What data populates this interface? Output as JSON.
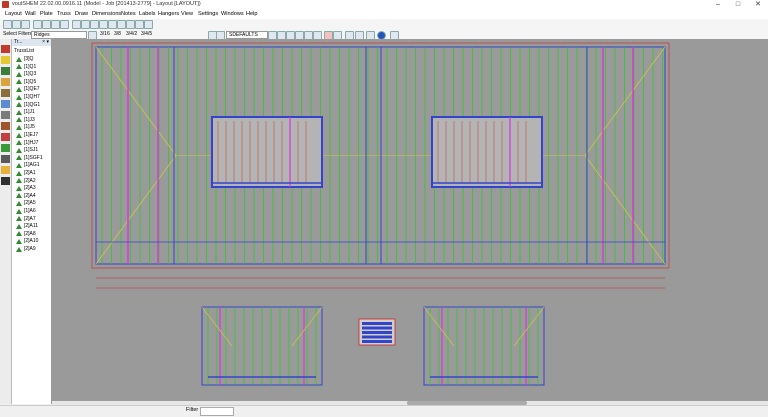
{
  "window": {
    "title": "voutSHEM 22.02.00.0916.11 (Model - Job [201413-2779] - Layout [LAYOUT])",
    "minimize": "–",
    "maximize": "□",
    "close": "✕"
  },
  "menu": [
    "Layout",
    "Wall",
    "Plate",
    "Truss",
    "Draw",
    "Dimensions",
    "Notes",
    "Labels",
    "Hangers",
    "View",
    "Settings",
    "Windows",
    "Help"
  ],
  "toolbar2": {
    "select_filters_label": "Select Filters",
    "filter_value": "Ridges",
    "pitch_a": "3/16",
    "pitch_b": "3/8",
    "pitch_c": "3/4/2",
    "pitch_d": "3/4/5",
    "layer_value": "SDEFAULTS"
  },
  "tree": {
    "header": "Tr...",
    "root": "TrussList",
    "items": [
      "[3]Q",
      "[1]Q1",
      "[1]Q3",
      "[1]Q5",
      "[1]QE7",
      "[1]QH7",
      "[1]QG1",
      "[1]J1",
      "[1]J3",
      "[1]J5",
      "[1]EJ7",
      "[1]HJ7",
      "[1]SJ1",
      "[1]SGF1",
      "[1]AG1",
      "[2]A1",
      "[2]A2",
      "[2]A3",
      "[2]A4",
      "[2]A5",
      "[1]A6",
      "[2]A7",
      "[2]A11",
      "[2]A8",
      "[2]A10",
      "[2]A9"
    ]
  },
  "status": {
    "filter_label": "Filter"
  },
  "colors": {
    "canvas_bg": "#9a9a9a",
    "truss_green": "#22cc22",
    "girder_magenta": "#dd33dd",
    "wall_blue": "#3344cc",
    "dim_red": "#cc2222",
    "hip_yellow": "#c8c84a"
  }
}
